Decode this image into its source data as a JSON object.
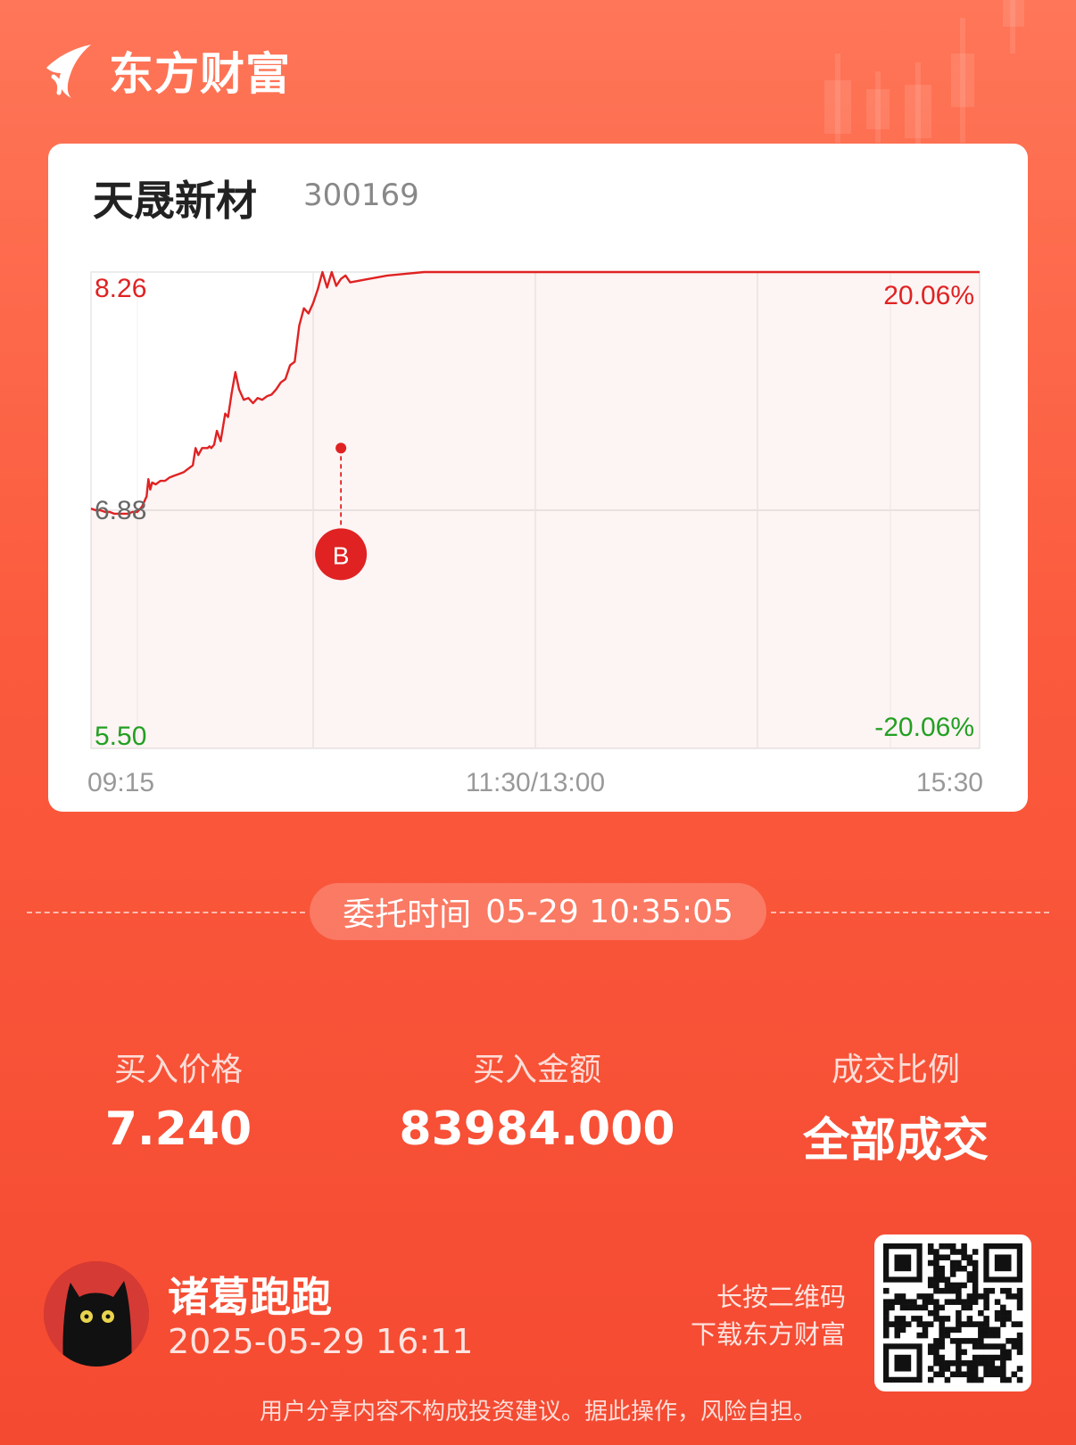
{
  "brand": {
    "name": "东方财富"
  },
  "stock": {
    "name": "天晟新材",
    "code": "300169"
  },
  "chart_data": {
    "type": "line",
    "y_axis_left": [
      "8.26",
      "6.88",
      "5.50"
    ],
    "y_axis_right": [
      "20.06%",
      "-20.06%"
    ],
    "x_axis": [
      "09:15",
      "11:30/13:00",
      "15:30"
    ],
    "ylim": [
      5.5,
      8.26
    ],
    "prev_close": 6.88,
    "x": [
      0,
      5,
      10,
      15,
      20,
      25,
      30,
      35,
      40,
      45,
      50,
      55,
      60,
      62,
      64,
      66,
      70,
      75,
      80,
      85,
      90,
      95,
      100,
      105,
      110,
      113,
      116,
      120,
      124,
      126,
      128,
      130,
      133,
      136,
      140,
      145,
      148,
      152,
      156,
      160,
      165,
      170,
      175,
      180,
      185,
      190,
      195,
      200,
      205,
      210,
      215,
      220,
      225,
      230,
      235,
      240,
      245,
      250,
      255,
      260,
      265,
      270,
      275,
      280,
      300,
      320,
      340,
      360,
      380,
      400,
      420,
      450,
      480,
      510,
      540,
      570,
      600,
      630,
      660,
      690,
      720,
      750,
      780,
      810,
      840,
      870,
      900,
      930,
      960
    ],
    "y": [
      6.89,
      6.88,
      6.88,
      6.87,
      6.87,
      6.86,
      6.86,
      6.86,
      6.86,
      6.87,
      6.87,
      6.9,
      6.96,
      7.06,
      7.0,
      7.04,
      7.03,
      7.05,
      7.05,
      7.07,
      7.08,
      7.09,
      7.1,
      7.12,
      7.14,
      7.24,
      7.2,
      7.24,
      7.24,
      7.24,
      7.25,
      7.24,
      7.26,
      7.34,
      7.28,
      7.44,
      7.42,
      7.56,
      7.68,
      7.58,
      7.52,
      7.53,
      7.5,
      7.53,
      7.52,
      7.54,
      7.55,
      7.58,
      7.62,
      7.64,
      7.72,
      7.74,
      7.95,
      8.05,
      8.02,
      8.08,
      8.16,
      8.26,
      8.17,
      8.26,
      8.18,
      8.22,
      8.24,
      8.2,
      8.22,
      8.24,
      8.25,
      8.26,
      8.26,
      8.26,
      8.26,
      8.26,
      8.26,
      8.26,
      8.26,
      8.26,
      8.26,
      8.26,
      8.26,
      8.26,
      8.26,
      8.26,
      8.26,
      8.26,
      8.26,
      8.26,
      8.26,
      8.26,
      8.26
    ],
    "x_max": 960,
    "buy_marker": {
      "x": 270,
      "price": 7.24,
      "label": "B"
    }
  },
  "order": {
    "label": "委托时间",
    "time": "05-29 10:35:05"
  },
  "stats": [
    {
      "label": "买入价格",
      "value": "7.240"
    },
    {
      "label": "买入金额",
      "value": "83984.000"
    },
    {
      "label": "成交比例",
      "value": "全部成交"
    }
  ],
  "user": {
    "name": "诸葛跑跑",
    "time": "2025-05-29 16:11"
  },
  "qr_hint": [
    "长按二维码",
    "下载东方财富"
  ],
  "disclaimer": "用户分享内容不构成投资建议。据此操作，风险自担。",
  "colors": {
    "up": "#e02222",
    "down": "#22a022",
    "accent": "#f44a31"
  }
}
